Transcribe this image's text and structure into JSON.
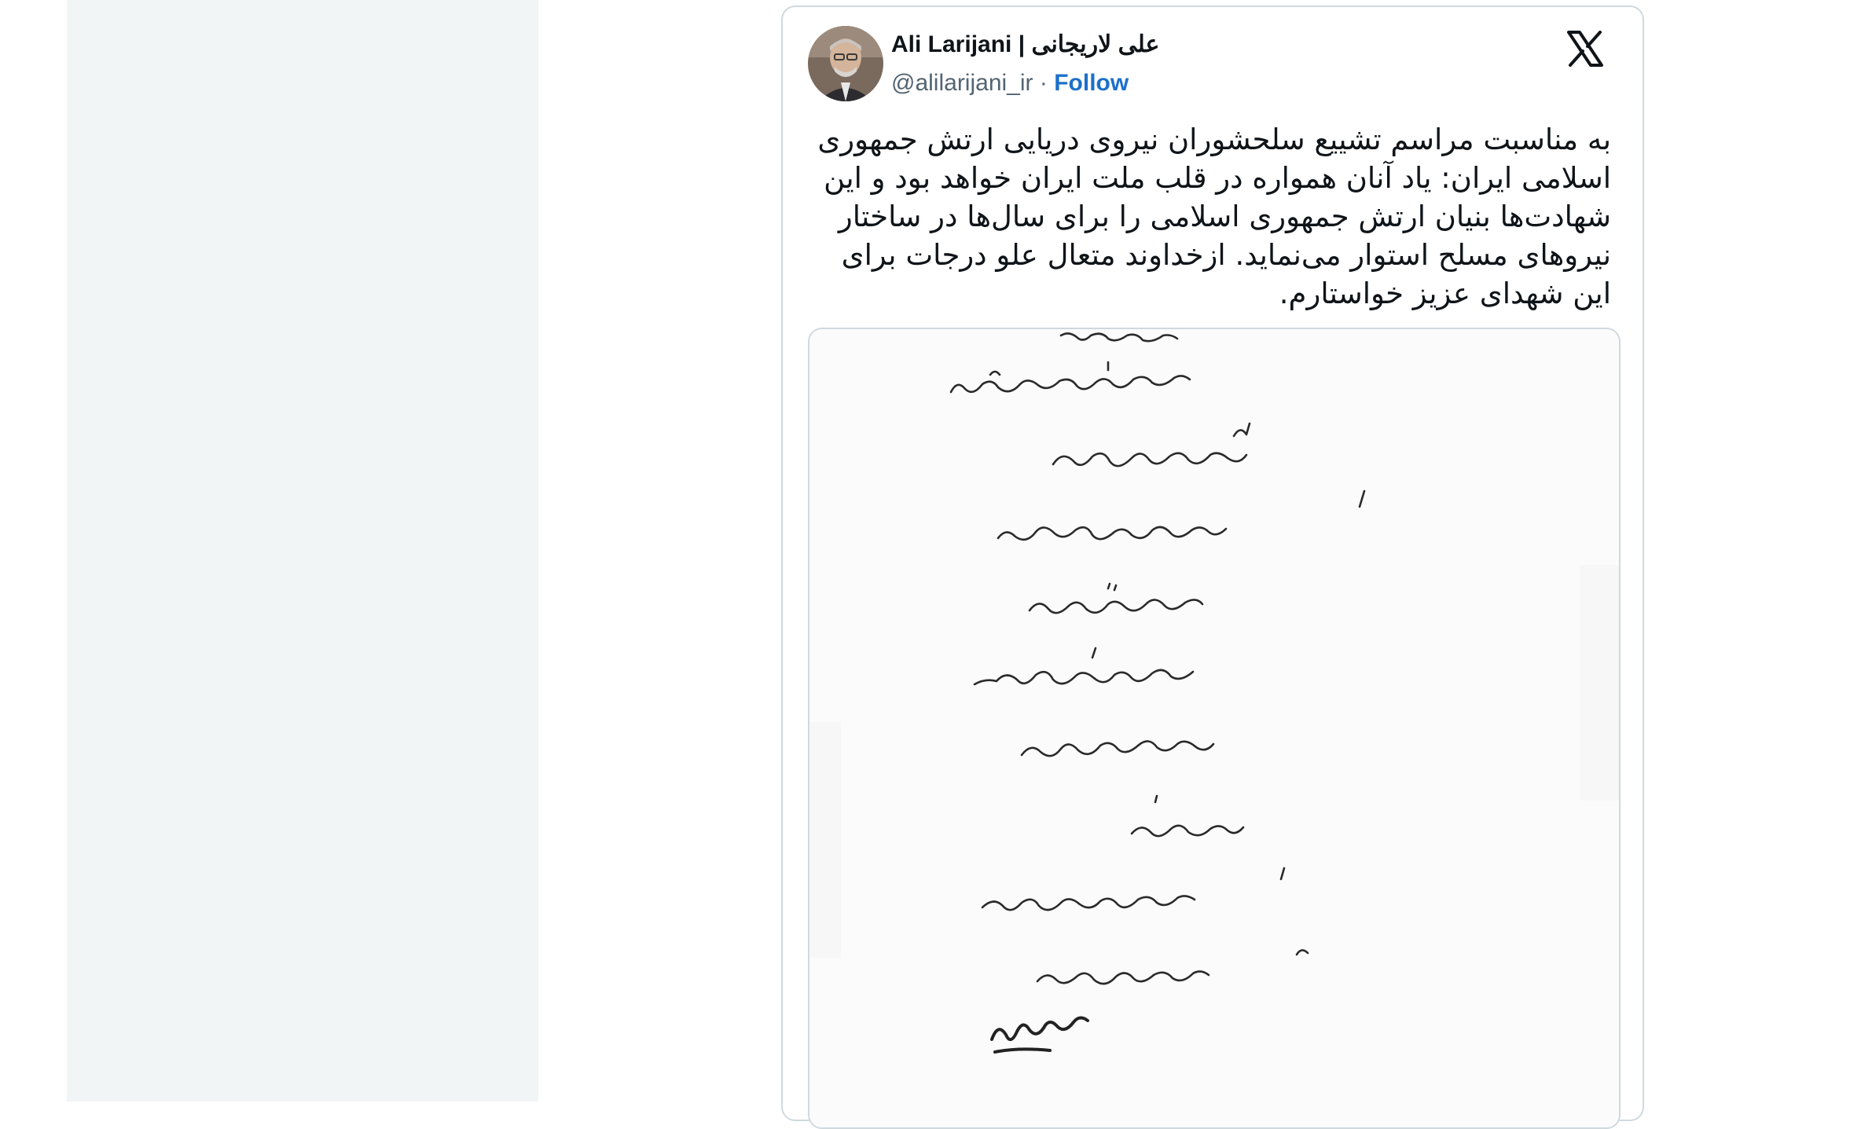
{
  "tweet": {
    "author": {
      "name": "Ali Larijani | علی لاریجانی",
      "handle": "@alilarijani_ir",
      "separator": "·",
      "follow_label": "Follow"
    },
    "text": "به مناسبت مراسم تشییع سلحشوران نیروی دریایی ارتش جمهوری اسلامی ایران: یاد آنان همواره در قلب ملت ایران خواهد بود و این شهادت‌ها بنیان ارتش جمهوری اسلامی را برای سال‌ها در ساختار نیروهای مسلح استوار می‌نماید. ازخداوند متعال علو درجات برای این شهدای عزیز خواستارم.",
    "media": {
      "type": "handwritten-letter-image"
    }
  },
  "icons": {
    "platform": "x-logo-icon",
    "avatar": "profile-photo"
  },
  "colors": {
    "link": "#1d70c9",
    "border": "#cfd9de",
    "side_panel": "#f2f5f6",
    "text": "#0f1419",
    "muted": "#536471"
  }
}
